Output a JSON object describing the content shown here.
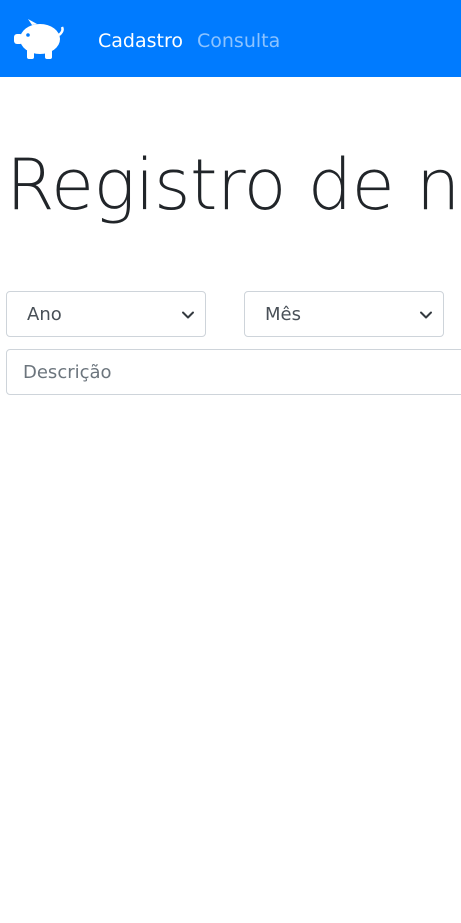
{
  "navbar": {
    "logo_icon": "piggy-bank-icon",
    "links": [
      {
        "label": "Cadastro",
        "active": true
      },
      {
        "label": "Consulta",
        "active": false
      }
    ],
    "bg_color": "#007bff"
  },
  "main": {
    "title": "Registro de nov"
  },
  "form": {
    "ano_select": {
      "selected": "Ano"
    },
    "mes_select": {
      "selected": "Mês"
    },
    "descricao_input": {
      "placeholder": "Descrição",
      "value": ""
    }
  }
}
